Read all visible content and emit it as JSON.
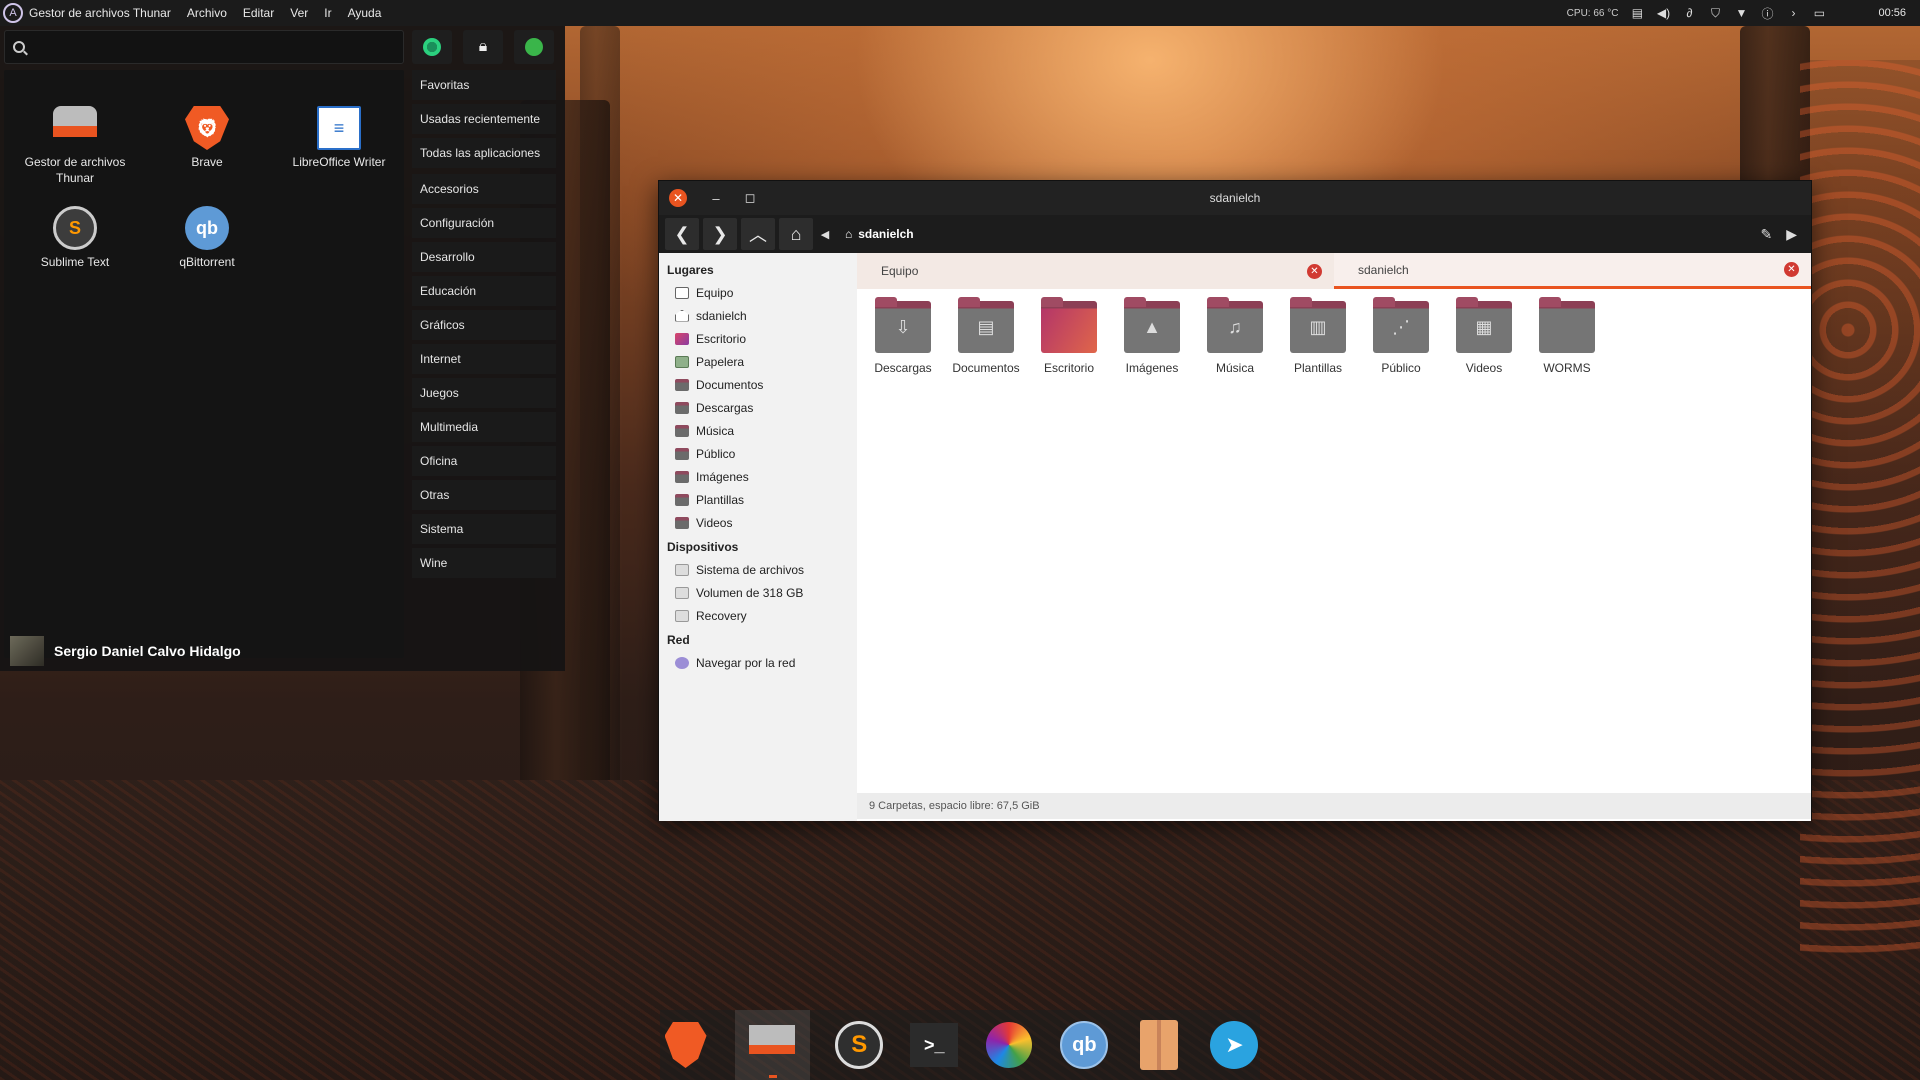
{
  "top_panel": {
    "app_name": "Gestor de archivos Thunar",
    "menu": [
      "Archivo",
      "Editar",
      "Ver",
      "Ir",
      "Ayuda"
    ],
    "cpu": "CPU: 66 °C",
    "clock": "00:56"
  },
  "whisker_menu": {
    "search_placeholder": "",
    "favorites": [
      {
        "label": "Gestor de archivos Thunar",
        "icon": "thunar-icon"
      },
      {
        "label": "Brave",
        "icon": "brave-icon"
      },
      {
        "label": "LibreOffice Writer",
        "icon": "writer-icon"
      },
      {
        "label": "Sublime Text",
        "icon": "sublime-icon"
      },
      {
        "label": "qBittorrent",
        "icon": "qbittorrent-icon"
      }
    ],
    "categories": [
      "Favoritas",
      "Usadas recientemente",
      "Todas las aplicaciones",
      "Accesorios",
      "Configuración",
      "Desarrollo",
      "Educación",
      "Gráficos",
      "Internet",
      "Juegos",
      "Multimedia",
      "Oficina",
      "Otras",
      "Sistema",
      "Wine"
    ],
    "user_name": "Sergio Daniel Calvo Hidalgo"
  },
  "thunar": {
    "title": "sdanielch",
    "path_crumb": "sdanielch",
    "sidebar": {
      "places_heading": "Lugares",
      "places": [
        "Equipo",
        "sdanielch",
        "Escritorio",
        "Papelera",
        "Documentos",
        "Descargas",
        "Música",
        "Público",
        "Imágenes",
        "Plantillas",
        "Videos"
      ],
      "devices_heading": "Dispositivos",
      "devices": [
        "Sistema de archivos",
        "Volumen de 318 GB",
        "Recovery"
      ],
      "network_heading": "Red",
      "network": [
        "Navegar por la red"
      ]
    },
    "tabs": [
      "Equipo",
      "sdanielch"
    ],
    "folders": [
      {
        "label": "Descargas",
        "glyph": "⇩"
      },
      {
        "label": "Documentos",
        "glyph": "▤"
      },
      {
        "label": "Escritorio",
        "glyph": ""
      },
      {
        "label": "Imágenes",
        "glyph": "▲"
      },
      {
        "label": "Música",
        "glyph": "♫"
      },
      {
        "label": "Plantillas",
        "glyph": "▥"
      },
      {
        "label": "Público",
        "glyph": "⋰"
      },
      {
        "label": "Videos",
        "glyph": "▦"
      },
      {
        "label": "WORMS",
        "glyph": ""
      }
    ],
    "status": "9 Carpetas, espacio libre: 67,5 GiB"
  },
  "dock": [
    "brave-icon",
    "thunar-icon",
    "sublime-icon",
    "terminal-icon",
    "image-viewer-icon",
    "qbittorrent-icon",
    "archive-manager-icon",
    "telegram-icon"
  ],
  "colors": {
    "accent": "#e95420",
    "folder": "#757575",
    "folder_tab": "#8c3f55"
  }
}
